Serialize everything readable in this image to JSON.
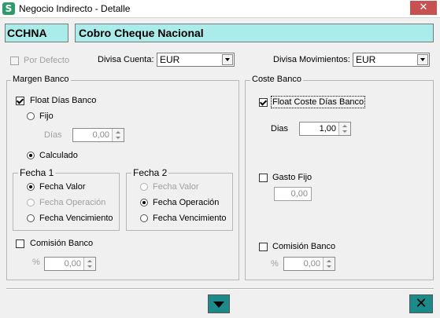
{
  "window": {
    "title": "Negocio Indirecto - Detalle",
    "close_glyph": "✕"
  },
  "header": {
    "code": "CCHNA",
    "description": "Cobro Cheque Nacional"
  },
  "options": {
    "por_defecto": {
      "label": "Por Defecto",
      "checked": false,
      "enabled": false
    },
    "divisa_cuenta": {
      "label": "Divisa Cuenta:",
      "value": "EUR"
    },
    "divisa_movimientos": {
      "label": "Divisa Movimientos:",
      "value": "EUR"
    }
  },
  "margen_banco": {
    "title": "Margen Banco",
    "float_dias": {
      "label": "Float Días Banco",
      "checked": true
    },
    "fijo": {
      "label": "Fijo",
      "checked": false
    },
    "dias": {
      "label": "Días",
      "value": "0,00"
    },
    "calculado": {
      "label": "Calculado",
      "checked": true
    },
    "fecha1": {
      "title": "Fecha 1",
      "options": [
        {
          "label": "Fecha Valor",
          "checked": true,
          "enabled": true
        },
        {
          "label": "Fecha Operación",
          "checked": false,
          "enabled": false
        },
        {
          "label": "Fecha Vencimiento",
          "checked": false,
          "enabled": true
        }
      ]
    },
    "fecha2": {
      "title": "Fecha 2",
      "options": [
        {
          "label": "Fecha Valor",
          "checked": false,
          "enabled": false
        },
        {
          "label": "Fecha Operación",
          "checked": true,
          "enabled": true
        },
        {
          "label": "Fecha Vencimiento",
          "checked": false,
          "enabled": true
        }
      ]
    },
    "comision": {
      "label": "Comisión Banco",
      "checked": false
    },
    "pct": {
      "label": "%",
      "value": "0,00"
    }
  },
  "coste_banco": {
    "title": "Coste Banco",
    "float_coste": {
      "label": "Float Coste Días Banco",
      "checked": true
    },
    "dias": {
      "label": "Dias",
      "value": "1,00"
    },
    "gasto_fijo": {
      "label": "Gasto Fijo",
      "checked": false,
      "value": "0,00"
    },
    "comision": {
      "label": "Comisión Banco",
      "checked": false
    },
    "pct": {
      "label": "%",
      "value": "0,00"
    }
  },
  "footer": {
    "close_glyph": "✕"
  }
}
